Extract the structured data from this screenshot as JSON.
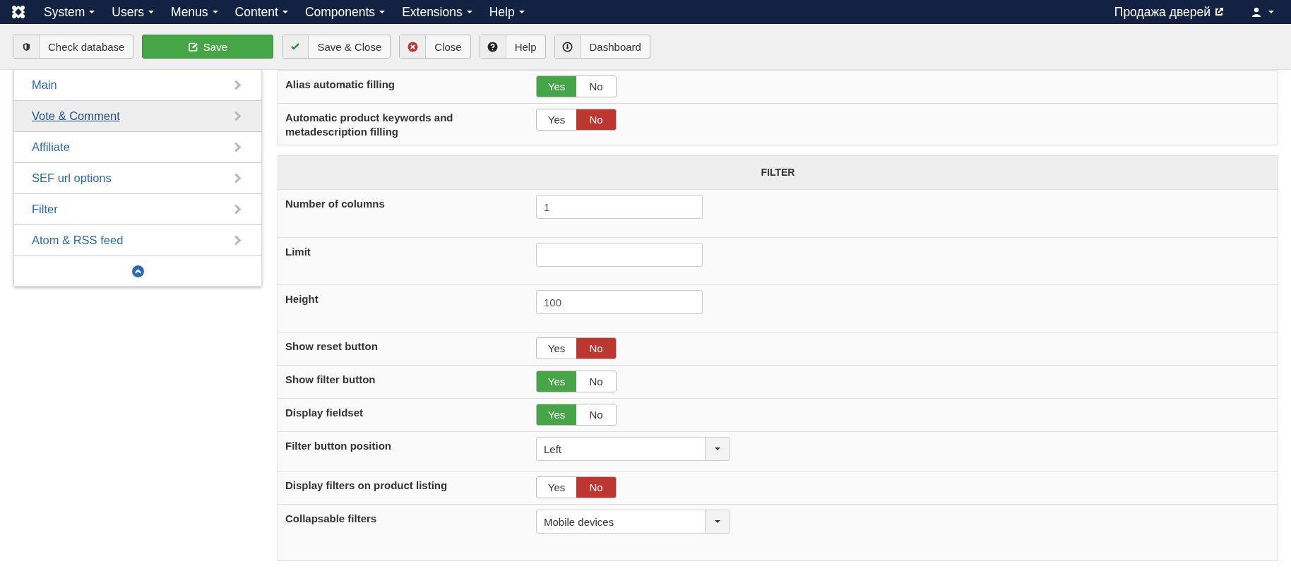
{
  "navbar": {
    "menus": [
      "System",
      "Users",
      "Menus",
      "Content",
      "Components",
      "Extensions",
      "Help"
    ],
    "site_link": "Продажа дверей"
  },
  "toolbar": [
    {
      "label": "Check database",
      "kind": "shield"
    },
    {
      "label": "Save",
      "kind": "save"
    },
    {
      "label": "Save & Close",
      "kind": "check"
    },
    {
      "label": "Close",
      "kind": "close"
    },
    {
      "label": "Help",
      "kind": "help"
    },
    {
      "label": "Dashboard",
      "kind": "dashboard"
    }
  ],
  "sidebar": {
    "items": [
      {
        "label": "Main",
        "selected": false
      },
      {
        "label": "Vote & Comment",
        "selected": true
      },
      {
        "label": "Affiliate",
        "selected": false
      },
      {
        "label": "SEF url options",
        "selected": false
      },
      {
        "label": "Filter",
        "selected": false
      },
      {
        "label": "Atom & RSS feed",
        "selected": false
      }
    ]
  },
  "panels": [
    {
      "rows": [
        {
          "label": "Alias automatic filling",
          "kind": "toggle",
          "options": [
            {
              "label": "Yes",
              "selected": true
            },
            {
              "label": "No",
              "selected": false
            }
          ]
        },
        {
          "label": "Automatic product keywords and metadescription filling",
          "kind": "toggle",
          "options": [
            {
              "label": "Yes",
              "selected": false
            },
            {
              "label": "No",
              "selected": true
            }
          ]
        }
      ]
    },
    {
      "title": "FILTER",
      "rows": [
        {
          "label": "Number of columns",
          "kind": "text",
          "value": "1"
        },
        {
          "label": "Limit",
          "kind": "text"
        },
        {
          "label": "Height",
          "kind": "text",
          "value": "100"
        },
        {
          "label": "Show reset button",
          "kind": "toggle",
          "options": [
            {
              "label": "Yes",
              "selected": false
            },
            {
              "label": "No",
              "selected": true
            }
          ]
        },
        {
          "label": "Show filter button",
          "kind": "toggle",
          "options": [
            {
              "label": "Yes",
              "selected": true
            },
            {
              "label": "No",
              "selected": false
            }
          ]
        },
        {
          "label": "Display fieldset",
          "kind": "toggle",
          "options": [
            {
              "label": "Yes",
              "selected": true
            },
            {
              "label": "No",
              "selected": false
            }
          ]
        },
        {
          "label": "Filter button position",
          "kind": "select",
          "value": "Left"
        },
        {
          "label": "Display filters on product listing",
          "kind": "toggle",
          "options": [
            {
              "label": "Yes",
              "selected": false
            },
            {
              "label": "No",
              "selected": true
            }
          ]
        },
        {
          "label": "Collapsable filters",
          "kind": "select",
          "value": "Mobile devices"
        }
      ]
    }
  ]
}
